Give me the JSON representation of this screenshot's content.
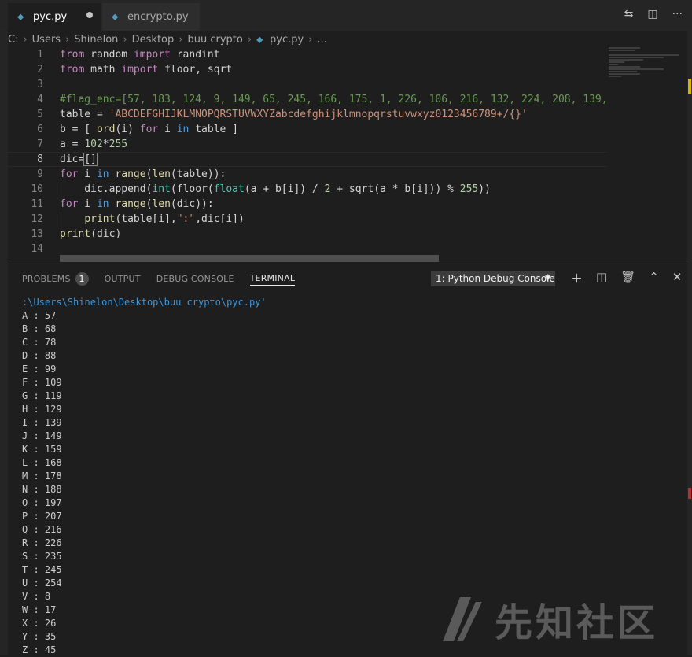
{
  "tabs": [
    {
      "label": "pyc.py",
      "active": true,
      "modified": true
    },
    {
      "label": "encrypto.py",
      "active": false
    }
  ],
  "breadcrumb": [
    "C:",
    "Users",
    "Shinelon",
    "Desktop",
    "buu crypto",
    "pyc.py",
    "..."
  ],
  "editor": {
    "line_numbers": [
      "1",
      "2",
      "3",
      "4",
      "5",
      "6",
      "7",
      "8",
      "9",
      "10",
      "11",
      "12",
      "13",
      "14"
    ],
    "current_line": "8"
  },
  "panel": {
    "tabs": [
      "PROBLEMS",
      "OUTPUT",
      "DEBUG CONSOLE",
      "TERMINAL"
    ],
    "problems_count": "1",
    "terminal_select": "1: Python Debug Console"
  },
  "terminal": {
    "path_line": ":\\Users\\Shinelon\\Desktop\\buu crypto\\pyc.py'",
    "lines": [
      "A : 57",
      "B : 68",
      "C : 78",
      "D : 88",
      "E : 99",
      "F : 109",
      "G : 119",
      "H : 129",
      "I : 139",
      "J : 149",
      "K : 159",
      "L : 168",
      "M : 178",
      "N : 188",
      "O : 197",
      "P : 207",
      "Q : 216",
      "R : 226",
      "S : 235",
      "T : 245",
      "U : 254",
      "V : 8",
      "W : 17",
      "X : 26",
      "Y : 35",
      "Z : 45"
    ]
  },
  "watermark": {
    "text": "先知社区"
  },
  "colors": {
    "editor_bg": "#1e1e1e",
    "tabbar_bg": "#252526",
    "keyword": "#c586c0",
    "string": "#ce9178",
    "comment": "#6a9955",
    "number": "#b5cea8",
    "terminal_path": "#3a96dd"
  }
}
